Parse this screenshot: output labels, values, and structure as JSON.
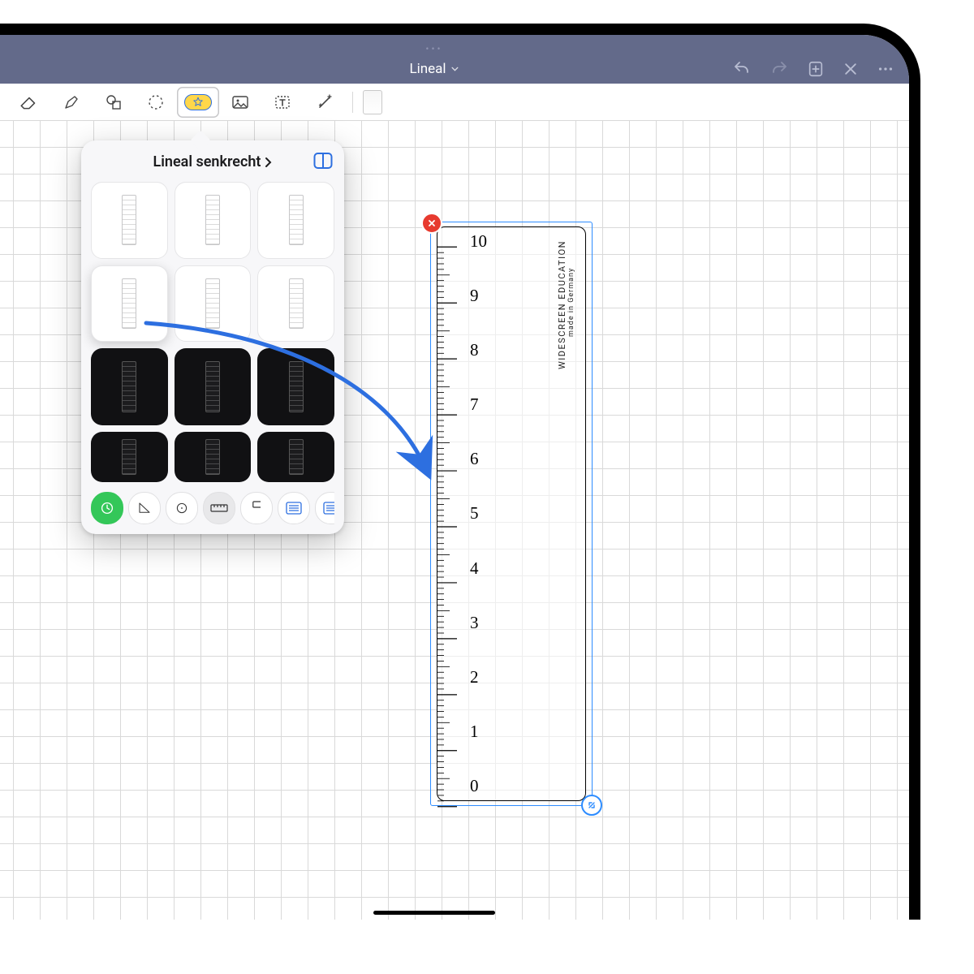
{
  "title": "Lineal",
  "popover": {
    "title": "Lineal senkrecht",
    "footer_icons": [
      "recent",
      "triangle",
      "circle",
      "ruler-h",
      "ruler-v",
      "lined",
      "lined-alt"
    ],
    "selected_footer": 0,
    "selected_card": 3
  },
  "ruler": {
    "numbers": [
      "0",
      "1",
      "2",
      "3",
      "4",
      "5",
      "6",
      "7",
      "8",
      "9",
      "10"
    ],
    "brand_line1": "WIDESCREEN EDUCATION",
    "brand_line2": "made in Germany"
  },
  "colors": {
    "accent_blue": "#2d6fe0",
    "green": "#34c759"
  }
}
